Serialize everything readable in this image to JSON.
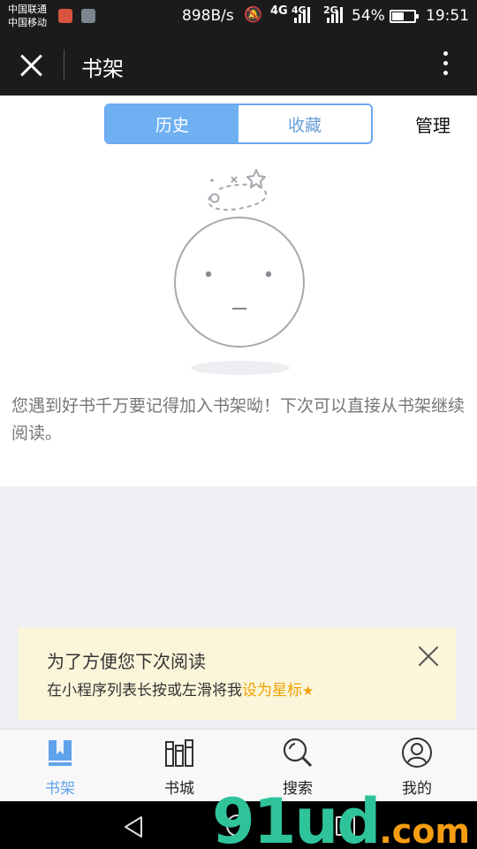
{
  "status_bar": {
    "carrier_1": "中国联通",
    "carrier_2": "中国移动",
    "network_speed": "898B/s",
    "network_1": "4G",
    "network_2": "4G",
    "network_3": "2G",
    "battery_percent": "54%",
    "battery_level": 0.54,
    "time": "19:51"
  },
  "title_bar": {
    "close_icon": "close-icon",
    "title": "书架",
    "more_icon": "more-vertical-icon"
  },
  "segment": {
    "tabs": [
      {
        "label": "历史",
        "active": true
      },
      {
        "label": "收藏",
        "active": false
      }
    ],
    "manage_label": "管理"
  },
  "empty_state": {
    "illustration": "sleepy-face-icon",
    "message": "您遇到好书千万要记得加入书架呦！下次可以直接从书架继续阅读。"
  },
  "tip": {
    "title": "为了方便您下次阅读",
    "line_prefix": "在小程序列表长按或左滑将我",
    "line_highlight": "设为星标",
    "star": "★",
    "highlight_color": "#f2a000",
    "background": "#fbf6da"
  },
  "tab_bar": {
    "items": [
      {
        "label": "书架",
        "icon": "book-icon",
        "active": true
      },
      {
        "label": "书城",
        "icon": "bookshelf-icon",
        "active": false
      },
      {
        "label": "搜索",
        "icon": "search-icon",
        "active": false
      },
      {
        "label": "我的",
        "icon": "user-icon",
        "active": false
      }
    ],
    "active_color": "#5fa3ec"
  },
  "watermark": {
    "number": "91ud",
    "domain": ".com"
  },
  "colors": {
    "accent": "#6eb0f2",
    "title_bar": "#1b1b1b"
  }
}
